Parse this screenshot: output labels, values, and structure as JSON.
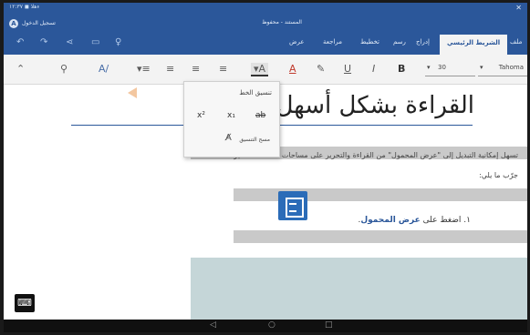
{
  "titlebar": {
    "status": "ءهلا ◼ ١٢:٣٧",
    "close": "✕",
    "avatar": "A",
    "sign_in": "تسجيل الدخول",
    "doc_title": "المستند - محفوظ"
  },
  "ribbon_tabs": [
    {
      "label": "ملف"
    },
    {
      "label": "الشريط الرئيسي",
      "active": true
    },
    {
      "label": "إدراج"
    },
    {
      "label": "رسم"
    },
    {
      "label": "تخطيط"
    },
    {
      "label": "مراجعة"
    },
    {
      "label": "عرض"
    }
  ],
  "ribbon": {
    "font_name": "Tahoma",
    "font_size": "30",
    "bold": "B",
    "italic": "I",
    "underline": "U",
    "highlight_icon": "pen-icon",
    "font_color_letter": "A",
    "font_color_letter2": "A"
  },
  "document": {
    "heading": "القراءة بشكل أسهل في",
    "para1": "تسهل إمكانية التبديل إلى \"عرض المحمول\" من القراءة والتحرير على مساحات الشاشة الصغيرة.",
    "para2": "جرّب ما يلي:",
    "step_number": "١.",
    "step_prefix": "اضغط على",
    "step_bold": "عرض المحمول",
    "step_suffix": "."
  },
  "font_menu": {
    "title": "تنسيق الخط",
    "superscript": "x²",
    "subscript": "x₁",
    "strikethrough": "ab",
    "clear_formatting": "مسح التنسيق"
  },
  "colors": {
    "accent": "#2b579a",
    "grey_band": "#c9c9c9",
    "teal_panel": "#c5d6d8"
  }
}
